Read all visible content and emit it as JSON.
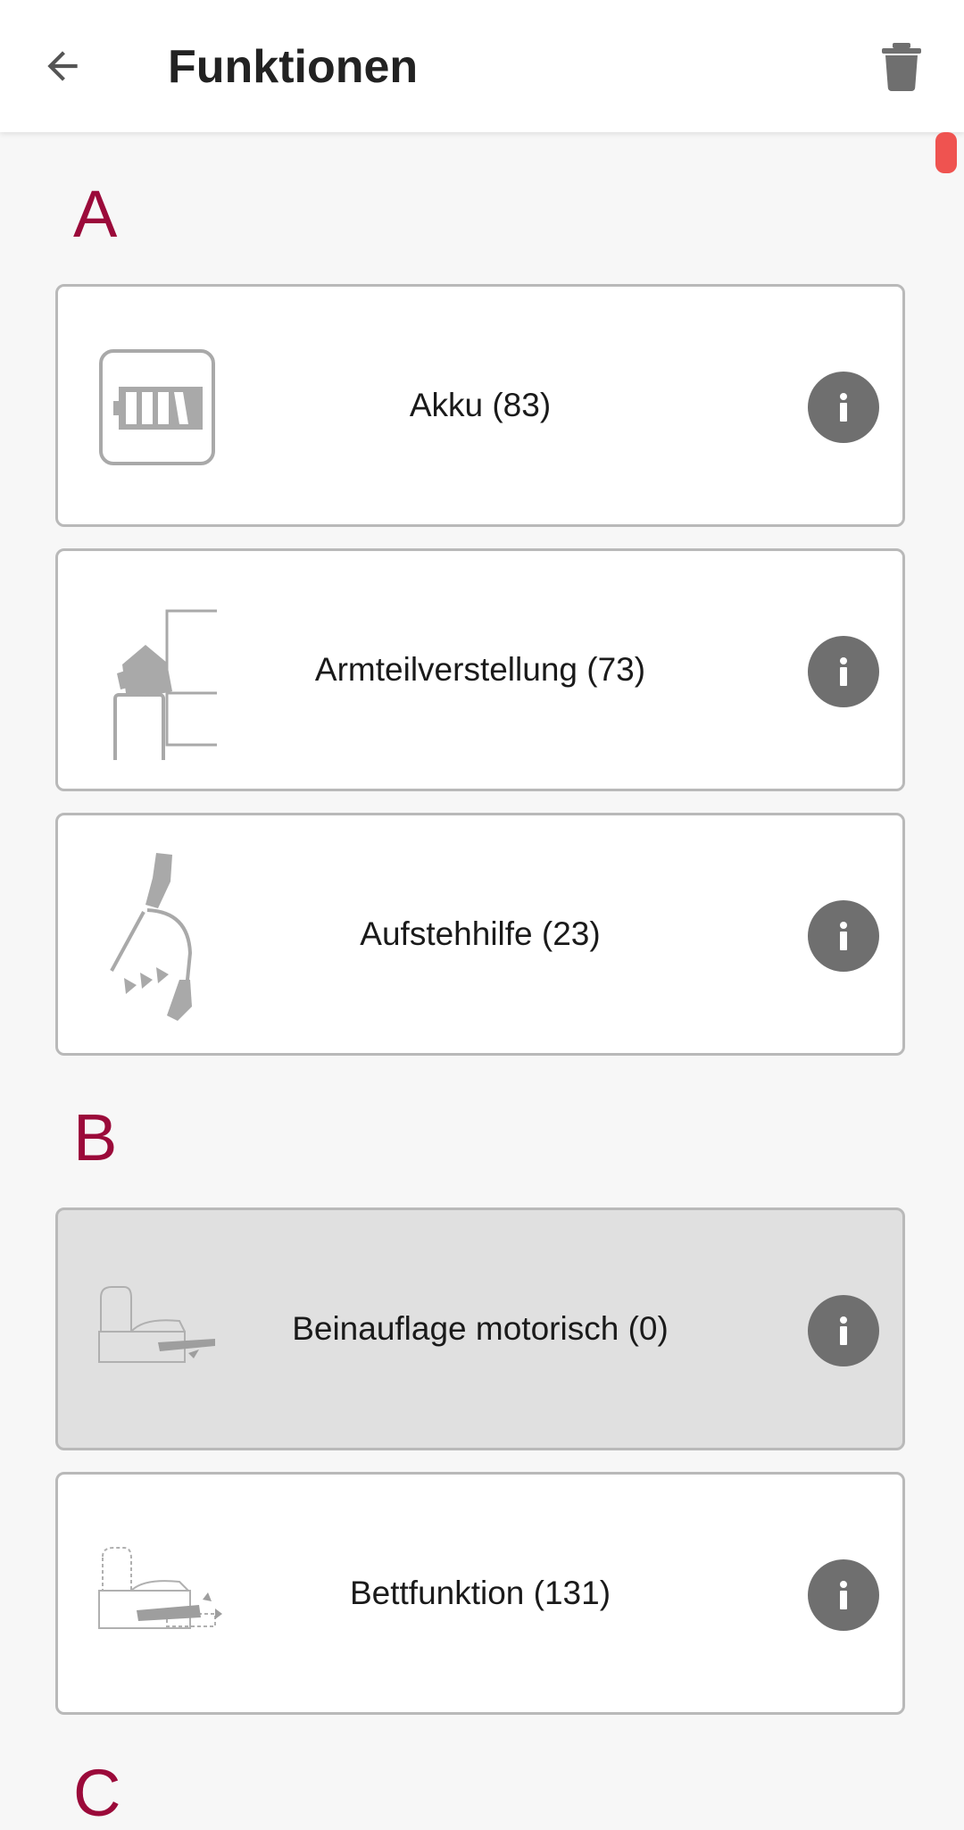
{
  "header": {
    "title": "Funktionen",
    "back_icon": "arrow-back-icon",
    "delete_icon": "trash-icon"
  },
  "colors": {
    "section_letter": "#9b0a3a",
    "scroll_indicator": "#ef5350",
    "info_button": "#6f6f6f"
  },
  "sections": [
    {
      "letter": "A",
      "items": [
        {
          "label": "Akku (83)",
          "icon": "battery-icon"
        },
        {
          "label": "Armteilverstellung (73)",
          "icon": "armrest-adjust-icon"
        },
        {
          "label": "Aufstehhilfe (23)",
          "icon": "standing-aid-icon"
        }
      ]
    },
    {
      "letter": "B",
      "items": [
        {
          "label": "Beinauflage motorisch (0)",
          "icon": "motor-legrest-icon"
        },
        {
          "label": "Bettfunktion (131)",
          "icon": "bed-function-icon"
        }
      ]
    },
    {
      "letter": "C",
      "items": []
    }
  ]
}
